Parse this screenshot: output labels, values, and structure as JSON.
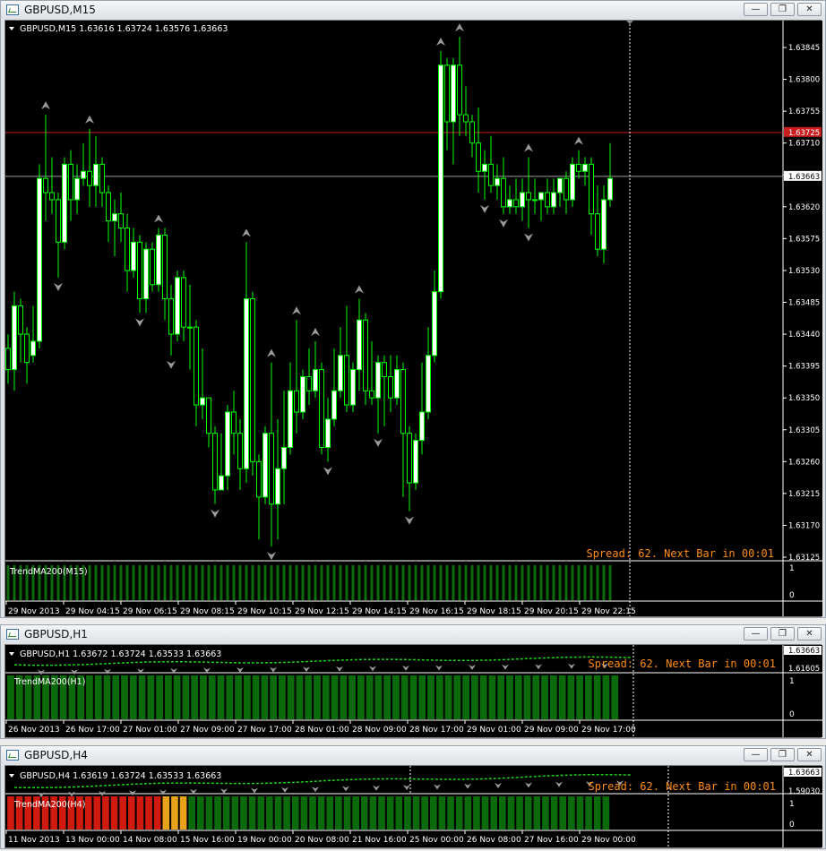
{
  "colors": {
    "bg": "#000000",
    "grid": "#ffffff",
    "bull": "#ffffff",
    "bullOutline": "#00ff00",
    "bear": "#000000",
    "wick": "#00ff00",
    "trendGreen": "#0b6b0b",
    "trendRed": "#d0190f",
    "trendOrange": "#e8a21a",
    "bidLine": "#c81e1e",
    "askLine": "#9a9a9a",
    "spread": "#ff8c1a"
  },
  "windows": [
    {
      "title": "GBPUSD,M15",
      "header": "GBPUSD,M15  1.63616 1.63724 1.63576 1.63663",
      "indicator_label": "TrendMA200(M15)",
      "spread_text": "Spread: 62. Next Bar in 00:01",
      "price_labels": [
        "1.63845",
        "1.63800",
        "1.63755",
        "1.63710",
        "1.63665",
        "1.63620",
        "1.63575",
        "1.63530",
        "1.63485",
        "1.63440",
        "1.63395",
        "1.63350",
        "1.63305",
        "1.63260",
        "1.63215",
        "1.63170",
        "1.63125"
      ],
      "bid_tag": "1.63725",
      "ask_tag": "1.63663",
      "ind_scale": [
        "1",
        "0"
      ],
      "time_labels": [
        "29 Nov 2013",
        "29 Nov 04:15",
        "29 Nov 06:15",
        "29 Nov 08:15",
        "29 Nov 10:15",
        "29 Nov 12:15",
        "29 Nov 14:15",
        "29 Nov 16:15",
        "29 Nov 18:15",
        "29 Nov 20:15",
        "29 Nov 22:15"
      ]
    },
    {
      "title": "GBPUSD,H1",
      "header": "GBPUSD,H1  1.63672 1.63724 1.63533 1.63663",
      "indicator_label": "TrendMA200(H1)",
      "spread_text": "Spread: 62. Next Bar in 00:01",
      "price_labels": [
        "1.63663",
        "1.61605"
      ],
      "ind_scale": [
        "1",
        "0"
      ],
      "time_labels": [
        "26 Nov 2013",
        "26 Nov 17:00",
        "27 Nov 01:00",
        "27 Nov 09:00",
        "27 Nov 17:00",
        "28 Nov 01:00",
        "28 Nov 09:00",
        "28 Nov 17:00",
        "29 Nov 01:00",
        "29 Nov 09:00",
        "29 Nov 17:00"
      ]
    },
    {
      "title": "GBPUSD,H4",
      "header": "GBPUSD,H4  1.63619 1.63724 1.63533 1.63663",
      "indicator_label": "TrendMA200(H4)",
      "spread_text": "Spread: 62. Next Bar in 00:01",
      "price_labels": [
        "1.63663",
        "1.59030"
      ],
      "ind_scale": [
        "1",
        "0"
      ],
      "time_labels": [
        "11 Nov 2013",
        "13 Nov 00:00",
        "14 Nov 08:00",
        "15 Nov 16:00",
        "19 Nov 00:00",
        "20 Nov 08:00",
        "21 Nov 16:00",
        "25 Nov 00:00",
        "26 Nov 08:00",
        "27 Nov 16:00",
        "29 Nov 00:00"
      ]
    }
  ],
  "buttons": {
    "minimize": "—",
    "restore": "❐",
    "close": "✕"
  },
  "m15_candles": [
    [
      1.6342,
      1.6339,
      1.6344,
      1.6337
    ],
    [
      1.6339,
      1.6348,
      1.635,
      1.6336
    ],
    [
      1.6348,
      1.6344,
      1.6349,
      1.634
    ],
    [
      1.6344,
      1.634,
      1.6345,
      1.6337
    ],
    [
      1.6341,
      1.6343,
      1.6348,
      1.634
    ],
    [
      1.6343,
      1.6366,
      1.6368,
      1.6342
    ],
    [
      1.6366,
      1.6364,
      1.6375,
      1.636
    ],
    [
      1.6364,
      1.6363,
      1.6369,
      1.6361
    ],
    [
      1.6363,
      1.6357,
      1.6364,
      1.6352
    ],
    [
      1.6357,
      1.6368,
      1.6369,
      1.6356
    ],
    [
      1.6368,
      1.6363,
      1.637,
      1.636
    ],
    [
      1.6363,
      1.6366,
      1.6368,
      1.6361
    ],
    [
      1.6366,
      1.6367,
      1.6371,
      1.6365
    ],
    [
      1.6367,
      1.6365,
      1.6373,
      1.6362
    ],
    [
      1.6365,
      1.6368,
      1.6372,
      1.6362
    ],
    [
      1.6368,
      1.6364,
      1.6369,
      1.6362
    ],
    [
      1.6364,
      1.636,
      1.6365,
      1.6357
    ],
    [
      1.636,
      1.6361,
      1.6363,
      1.6355
    ],
    [
      1.6361,
      1.6359,
      1.6364,
      1.6357
    ],
    [
      1.6359,
      1.6353,
      1.6361,
      1.635
    ],
    [
      1.6353,
      1.6357,
      1.6359,
      1.6352
    ],
    [
      1.6357,
      1.6349,
      1.6358,
      1.6347
    ],
    [
      1.6349,
      1.6356,
      1.6357,
      1.6347
    ],
    [
      1.6356,
      1.6351,
      1.6357,
      1.635
    ],
    [
      1.6351,
      1.6358,
      1.6359,
      1.635
    ],
    [
      1.6358,
      1.6349,
      1.6359,
      1.6346
    ],
    [
      1.6349,
      1.6344,
      1.6351,
      1.6341
    ],
    [
      1.6344,
      1.6352,
      1.6353,
      1.6343
    ],
    [
      1.6352,
      1.6345,
      1.6353,
      1.6343
    ],
    [
      1.6345,
      1.6345,
      1.6351,
      1.6339
    ],
    [
      1.6345,
      1.6334,
      1.6346,
      1.6331
    ],
    [
      1.6334,
      1.6335,
      1.6342,
      1.6332
    ],
    [
      1.6335,
      1.633,
      1.6335,
      1.6328
    ],
    [
      1.633,
      1.6322,
      1.6331,
      1.632
    ],
    [
      1.6322,
      1.6324,
      1.633,
      1.6322
    ],
    [
      1.6324,
      1.6333,
      1.6334,
      1.6322
    ],
    [
      1.6333,
      1.633,
      1.6336,
      1.6327
    ],
    [
      1.633,
      1.6325,
      1.6332,
      1.6322
    ],
    [
      1.6325,
      1.6349,
      1.6357,
      1.6323
    ],
    [
      1.6349,
      1.6326,
      1.635,
      1.6324
    ],
    [
      1.6326,
      1.6321,
      1.6327,
      1.6315
    ],
    [
      1.6321,
      1.633,
      1.6331,
      1.632
    ],
    [
      1.633,
      1.632,
      1.634,
      1.6314
    ],
    [
      1.632,
      1.6325,
      1.6332,
      1.6315
    ],
    [
      1.6325,
      1.6328,
      1.6336,
      1.632
    ],
    [
      1.6328,
      1.6336,
      1.634,
      1.6327
    ],
    [
      1.6336,
      1.6333,
      1.6346,
      1.633
    ],
    [
      1.6333,
      1.6338,
      1.6339,
      1.6332
    ],
    [
      1.6338,
      1.6336,
      1.6342,
      1.6334
    ],
    [
      1.6336,
      1.6339,
      1.6343,
      1.6335
    ],
    [
      1.6339,
      1.6328,
      1.634,
      1.6327
    ],
    [
      1.6328,
      1.6332,
      1.6335,
      1.6326
    ],
    [
      1.6332,
      1.6336,
      1.6342,
      1.6331
    ],
    [
      1.6336,
      1.6341,
      1.6345,
      1.6335
    ],
    [
      1.6341,
      1.6334,
      1.6348,
      1.6333
    ],
    [
      1.6334,
      1.6339,
      1.634,
      1.6333
    ],
    [
      1.6339,
      1.6346,
      1.6349,
      1.6336
    ],
    [
      1.6346,
      1.6336,
      1.6347,
      1.6334
    ],
    [
      1.6336,
      1.6335,
      1.6343,
      1.6334
    ],
    [
      1.6335,
      1.634,
      1.6341,
      1.633
    ],
    [
      1.634,
      1.6338,
      1.6341,
      1.6331
    ],
    [
      1.6338,
      1.6335,
      1.6341,
      1.6333
    ],
    [
      1.6335,
      1.6339,
      1.6341,
      1.6334
    ],
    [
      1.6339,
      1.633,
      1.634,
      1.6321
    ],
    [
      1.633,
      1.6323,
      1.6331,
      1.6319
    ],
    [
      1.6323,
      1.6329,
      1.633,
      1.6322
    ],
    [
      1.6329,
      1.6333,
      1.634,
      1.6327
    ],
    [
      1.6333,
      1.6341,
      1.6345,
      1.6332
    ],
    [
      1.6341,
      1.635,
      1.6353,
      1.634
    ],
    [
      1.635,
      1.6382,
      1.6384,
      1.6349
    ],
    [
      1.6382,
      1.6374,
      1.6383,
      1.637
    ],
    [
      1.6374,
      1.6382,
      1.6383,
      1.6368
    ],
    [
      1.6382,
      1.6375,
      1.6386,
      1.6372
    ],
    [
      1.6375,
      1.6374,
      1.6379,
      1.6372
    ],
    [
      1.6374,
      1.6371,
      1.6375,
      1.6369
    ],
    [
      1.6371,
      1.6367,
      1.6376,
      1.6364
    ],
    [
      1.6367,
      1.6368,
      1.637,
      1.6363
    ],
    [
      1.6368,
      1.6365,
      1.6372,
      1.6364
    ],
    [
      1.6365,
      1.6366,
      1.6368,
      1.6363
    ],
    [
      1.6366,
      1.6362,
      1.6369,
      1.6361
    ],
    [
      1.6362,
      1.6363,
      1.6365,
      1.6361
    ],
    [
      1.6363,
      1.6362,
      1.6366,
      1.6361
    ],
    [
      1.6362,
      1.6364,
      1.6366,
      1.636
    ],
    [
      1.6364,
      1.6363,
      1.6369,
      1.6359
    ],
    [
      1.6363,
      1.6363,
      1.6366,
      1.6361
    ],
    [
      1.6363,
      1.6364,
      1.6364,
      1.636
    ],
    [
      1.6364,
      1.6362,
      1.6366,
      1.6361
    ],
    [
      1.6362,
      1.6364,
      1.6366,
      1.6361
    ],
    [
      1.6364,
      1.6366,
      1.6366,
      1.6362
    ],
    [
      1.6366,
      1.6363,
      1.6367,
      1.6361
    ],
    [
      1.6363,
      1.6368,
      1.6369,
      1.6362
    ],
    [
      1.6368,
      1.6367,
      1.637,
      1.6366
    ],
    [
      1.6367,
      1.6368,
      1.6369,
      1.6365
    ],
    [
      1.6368,
      1.6361,
      1.6369,
      1.6358
    ],
    [
      1.6361,
      1.6356,
      1.6365,
      1.6355
    ],
    [
      1.6356,
      1.6363,
      1.6365,
      1.6354
    ],
    [
      1.6363,
      1.6366,
      1.6371,
      1.6362
    ]
  ]
}
